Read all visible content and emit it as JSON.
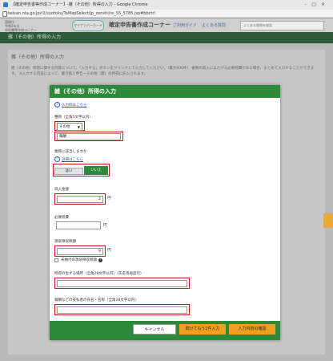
{
  "window": {
    "title": "【確定申告書等作成コーナー】-雑（その他）所得の入力 - Google Chrome",
    "url": "keisan.nta.go.jp/r2/syotoku/TaMapSelect/jp_zenshi/re_SS_5785.jsp#bbctrl"
  },
  "site": {
    "logo_line1": "国税庁",
    "logo_line2": "令和2年分",
    "logo_line3": "申告書等作成コーナー",
    "mynumber_label": "マイナンバーカード",
    "corner_title": "確定申告書作成コーナー",
    "guide_link": "ご利用ガイド",
    "faq_link": "よくある質問",
    "search_placeholder": "よくある質問を検索"
  },
  "page": {
    "breadcrumb": "雑（その他）所得の入力",
    "section_title": "雑（その他）所得の入力",
    "description": "雑（その他）所得に関する内容について、「入力する」ボタンをクリックして入力してください。（最大600件） 複数の収入にまたがる必要経費がある場合、まとめて入力することができます。 ※入力する内容によって、書き換え申告・その他（雑）の所得に記入されます。"
  },
  "dialog": {
    "title": "雑（その他）所得の入力",
    "help_link_top": "入力例はこちら",
    "type_label": "種目（全角5文字以内）",
    "type_selected": "その他",
    "type_value": "報酬",
    "question": "業務に該当しますか",
    "help_link_detail": "詳細はこちら",
    "yes_label": "はい",
    "no_label": "いいえ",
    "income_label": "収入金額",
    "income_value": "2",
    "expense_label": "必要経費",
    "expense_value": "",
    "withholding_label": "源泉徴収税額",
    "withholding_value": "9",
    "unpaid_label": "未納付の源泉徴収税額",
    "location_label": "所得の生ずる場所（全角28文字以内）（氏名等再度可）",
    "location_value": "",
    "payer_label": "報酬などの支払者の氏名・名称（全角28文字以内）",
    "payer_value": "",
    "unit": "円",
    "cancel_label": "キャンセル",
    "continue_label": "続けてもう1件入力",
    "confirm_label": "入力内容の確認"
  },
  "colors": {
    "dialog_header": "#2d8a3a",
    "highlight": "#d0121b",
    "action_button": "#f0a020"
  }
}
